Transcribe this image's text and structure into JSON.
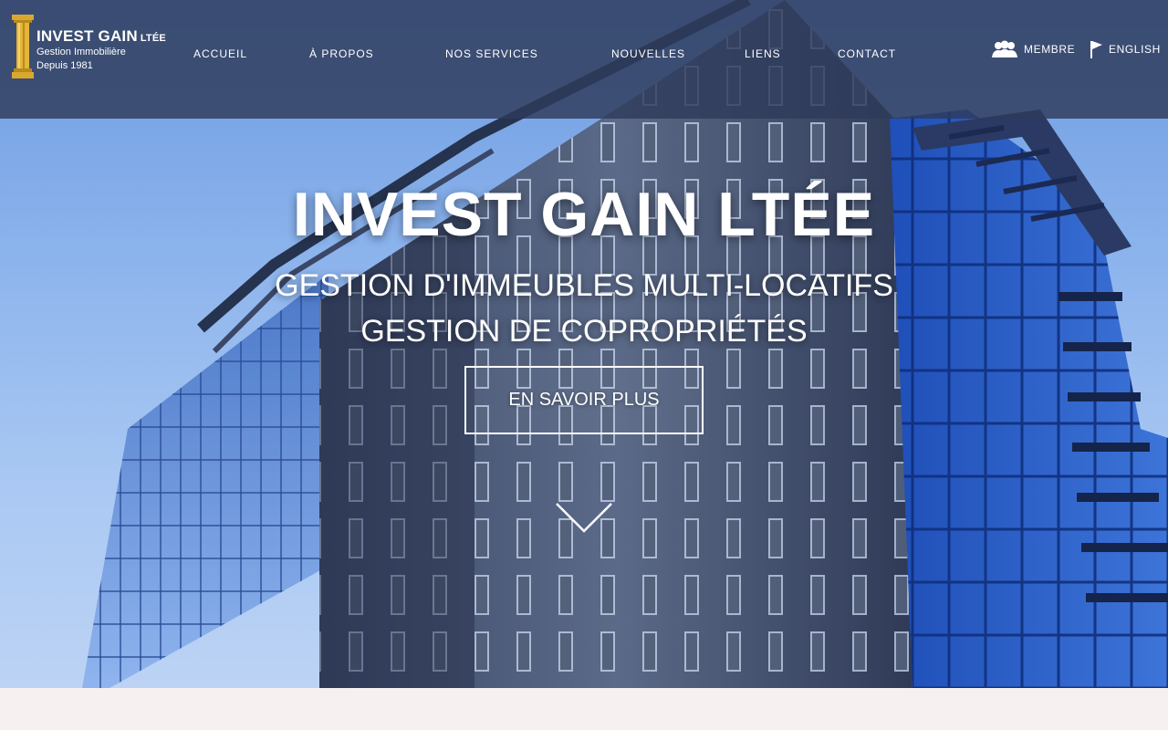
{
  "brand": {
    "name": "INVEST GAIN",
    "suffix": "LTÉE",
    "tagline": "Gestion Immobilière",
    "since": "Depuis 1981"
  },
  "nav": {
    "items": [
      {
        "label": "ACCUEIL"
      },
      {
        "label": "À PROPOS"
      },
      {
        "label": "NOS SERVICES"
      },
      {
        "label": "NOUVELLES"
      },
      {
        "label": "LIENS"
      },
      {
        "label": "CONTACT"
      }
    ]
  },
  "utility": {
    "member_label": "MEMBRE",
    "member_icon": "users-icon",
    "language_label": "ENGLISH",
    "language_icon": "flag-icon"
  },
  "hero": {
    "title": "INVEST GAIN LTÉE",
    "line1": "GESTION D'IMMEUBLES MULTI-LOCATIFS",
    "line2": "GESTION DE COPROPRIÉTÉS",
    "cta_label": "EN SAVOIR PLUS",
    "scroll_icon": "chevron-down-icon"
  },
  "colors": {
    "topbar": "#2e3a5a",
    "sky": "#8ab2ec",
    "logo_gold": "#d9a92e"
  }
}
